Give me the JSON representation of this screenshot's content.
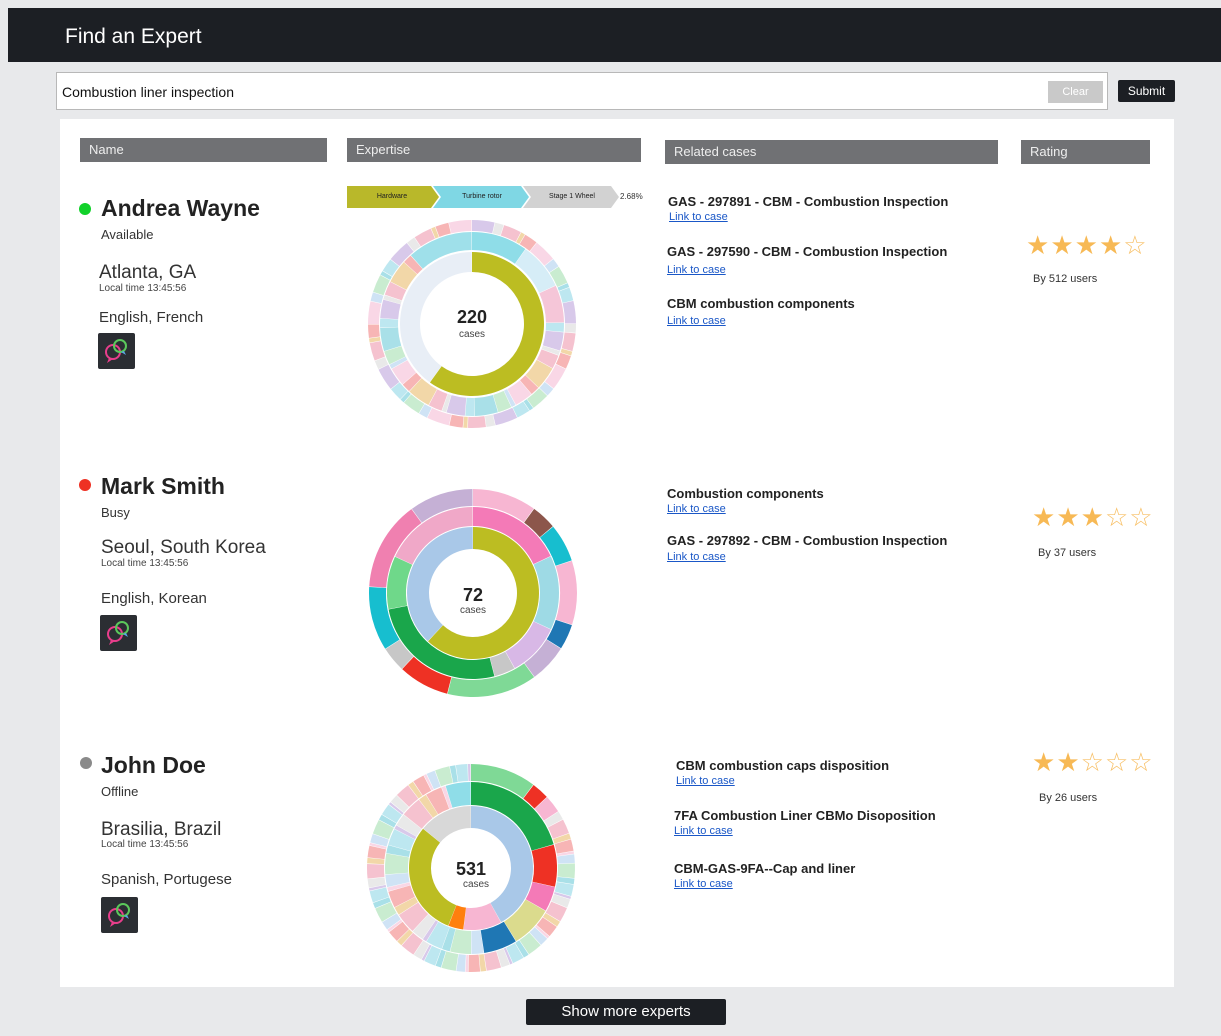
{
  "app": {
    "title": "Find an Expert"
  },
  "search": {
    "value": "Combustion liner inspection",
    "clear_label": "Clear",
    "submit_label": "Submit"
  },
  "columns": {
    "name": "Name",
    "expertise": "Expertise",
    "related": "Related cases",
    "rating": "Rating"
  },
  "breadcrumb": {
    "items": [
      "Hardware",
      "Turbine rotor",
      "Stage 1 Wheel"
    ],
    "percent": "2.68%"
  },
  "colors": {
    "available": "#11d12a",
    "busy": "#ee3124",
    "offline": "#8a8a8a",
    "star": "#f7b955",
    "link": "#1a57c7"
  },
  "experts": [
    {
      "name": "Andrea Wayne",
      "status": "Available",
      "status_color": "available",
      "city": "Atlanta, GA",
      "local_time": "Local time 13:45:56",
      "languages": "English, French",
      "case_count": "220",
      "case_count_label": "cases",
      "cases": [
        {
          "title": "GAS - 297891 - CBM - Combustion Inspection",
          "link": "Link to case"
        },
        {
          "title": "GAS - 297590 - CBM - Combustion Inspection",
          "link": "Link to case"
        },
        {
          "title": "CBM combustion components",
          "link": "Link to case"
        }
      ],
      "rating": 4,
      "rating_max": 5,
      "rated_by": "By 512 users"
    },
    {
      "name": "Mark Smith",
      "status": "Busy",
      "status_color": "busy",
      "city": "Seoul, South Korea",
      "local_time": "Local time 13:45:56",
      "languages": "English, Korean",
      "case_count": "72",
      "case_count_label": "cases",
      "cases": [
        {
          "title": "Combustion components",
          "link": "Link to case"
        },
        {
          "title": "GAS - 297892 - CBM - Combustion Inspection",
          "link": "Link to case"
        }
      ],
      "rating": 3,
      "rating_max": 5,
      "rated_by": "By 37 users"
    },
    {
      "name": "John Doe",
      "status": "Offline",
      "status_color": "offline",
      "city": "Brasilia, Brazil",
      "local_time": "Local time 13:45:56",
      "languages": "Spanish, Portugese",
      "case_count": "531",
      "case_count_label": "cases",
      "cases": [
        {
          "title": "CBM combustion caps disposition",
          "link": "Link to case"
        },
        {
          "title": "7FA Combustion Liner CBMo Disoposition",
          "link": "Link to case"
        },
        {
          "title": "CBM-GAS-9FA--Cap and liner",
          "link": "Link to case"
        }
      ],
      "rating": 2,
      "rating_max": 5,
      "rated_by": "By 26 users"
    }
  ],
  "footer": {
    "show_more_label": "Show more experts"
  }
}
